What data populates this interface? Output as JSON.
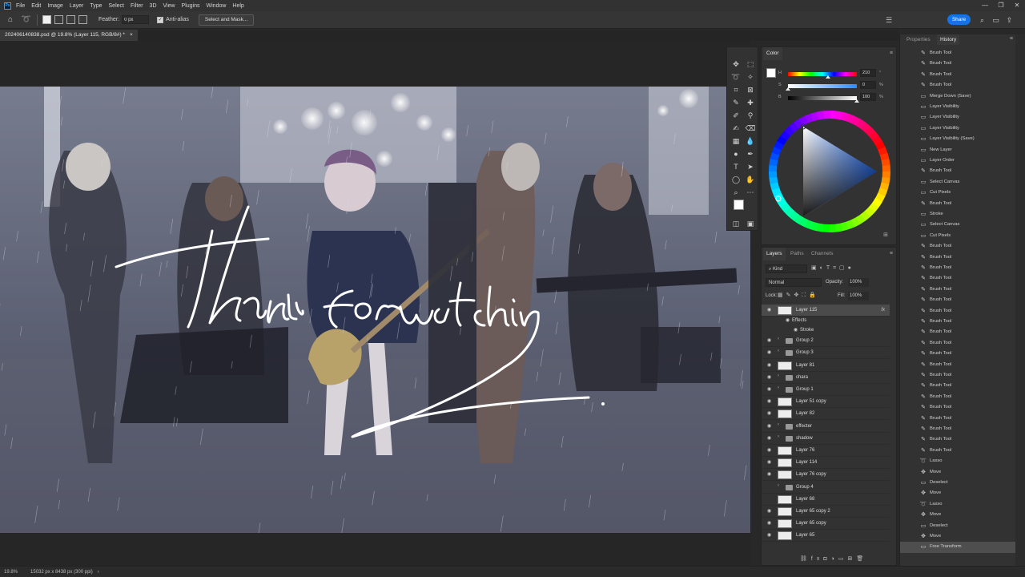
{
  "app": {
    "logo_text": "Ps"
  },
  "menu": [
    "File",
    "Edit",
    "Image",
    "Layer",
    "Type",
    "Select",
    "Filter",
    "3D",
    "View",
    "Plugins",
    "Window",
    "Help"
  ],
  "window_controls": {
    "minimize": "—",
    "restore": "❐",
    "close": "✕"
  },
  "options_bar": {
    "feather_label": "Feather:",
    "feather_value": "0 px",
    "antialias_label": "Anti-alias",
    "antialias_checked": true,
    "select_mask_label": "Select and Mask...",
    "share_label": "Share"
  },
  "document": {
    "tab_title": "202406140838.psd @ 19.8% (Layer 115, RGB/8#) *",
    "close_glyph": "×"
  },
  "artwork": {
    "handwriting": "Thanks for watching"
  },
  "color_panel": {
    "tab": "Color",
    "h_label": "H",
    "h_value": "210",
    "h_unit": "°",
    "s_label": "S",
    "s_value": "0",
    "s_unit": "%",
    "b_label": "B",
    "b_value": "100",
    "b_unit": "%",
    "h_fill": 0.58,
    "s_fill": 0.0,
    "b_fill": 1.0
  },
  "layers_panel": {
    "tabs": [
      "Layers",
      "Paths",
      "Channels"
    ],
    "kind_label": "Kind",
    "blend_mode": "Normal",
    "opacity_label": "Opacity:",
    "opacity_value": "100%",
    "lock_label": "Lock:",
    "fill_label": "Fill:",
    "fill_value": "100%",
    "fx_glyph": "fx",
    "layers": [
      {
        "name": "Layer 115",
        "type": "layer",
        "selected": true,
        "fx": true,
        "visible": true
      },
      {
        "name": "Effects",
        "type": "effect"
      },
      {
        "name": "Stroke",
        "type": "effect2"
      },
      {
        "name": "Group 2",
        "type": "group",
        "visible": true
      },
      {
        "name": "Group 3",
        "type": "group",
        "visible": true
      },
      {
        "name": "Layer 81",
        "type": "layer",
        "visible": true
      },
      {
        "name": "chara",
        "type": "group",
        "visible": true
      },
      {
        "name": "Group 1",
        "type": "group",
        "visible": true
      },
      {
        "name": "Layer 51 copy",
        "type": "layer",
        "visible": true
      },
      {
        "name": "Layer 82",
        "type": "layer",
        "visible": true
      },
      {
        "name": "effecter",
        "type": "group",
        "visible": true
      },
      {
        "name": "shadow",
        "type": "group",
        "visible": true
      },
      {
        "name": "Layer 76",
        "type": "layer",
        "visible": true
      },
      {
        "name": "Layer 114",
        "type": "layer",
        "visible": true
      },
      {
        "name": "Layer 76 copy",
        "type": "layer",
        "visible": true
      },
      {
        "name": "Group 4",
        "type": "group",
        "visible": false
      },
      {
        "name": "Layer 68",
        "type": "layer",
        "visible": false
      },
      {
        "name": "Layer 65 copy 2",
        "type": "layer",
        "visible": true
      },
      {
        "name": "Layer 65 copy",
        "type": "layer",
        "visible": true
      },
      {
        "name": "Layer 65",
        "type": "layer",
        "visible": true
      }
    ]
  },
  "history_panel": {
    "tabs": [
      "Properties",
      "History"
    ],
    "items": [
      {
        "label": "Brush Tool",
        "icon": "brush"
      },
      {
        "label": "Brush Tool",
        "icon": "brush"
      },
      {
        "label": "Brush Tool",
        "icon": "brush"
      },
      {
        "label": "Brush Tool",
        "icon": "brush"
      },
      {
        "label": "Merge Down (Save)",
        "icon": "layer"
      },
      {
        "label": "Layer Visibility",
        "icon": "layer"
      },
      {
        "label": "Layer Visibility",
        "icon": "layer"
      },
      {
        "label": "Layer Visibility",
        "icon": "layer"
      },
      {
        "label": "Layer Visibility (Save)",
        "icon": "layer"
      },
      {
        "label": "New Layer",
        "icon": "layer"
      },
      {
        "label": "Layer Order",
        "icon": "layer"
      },
      {
        "label": "Brush Tool",
        "icon": "brush"
      },
      {
        "label": "Select Canvas",
        "icon": "layer"
      },
      {
        "label": "Cut Pixels",
        "icon": "layer"
      },
      {
        "label": "Brush Tool",
        "icon": "brush"
      },
      {
        "label": "Stroke",
        "icon": "layer"
      },
      {
        "label": "Select Canvas",
        "icon": "layer"
      },
      {
        "label": "Cut Pixels",
        "icon": "layer"
      },
      {
        "label": "Brush Tool",
        "icon": "brush"
      },
      {
        "label": "Brush Tool",
        "icon": "brush"
      },
      {
        "label": "Brush Tool",
        "icon": "brush"
      },
      {
        "label": "Brush Tool",
        "icon": "brush"
      },
      {
        "label": "Brush Tool",
        "icon": "brush"
      },
      {
        "label": "Brush Tool",
        "icon": "brush"
      },
      {
        "label": "Brush Tool",
        "icon": "brush"
      },
      {
        "label": "Brush Tool",
        "icon": "brush"
      },
      {
        "label": "Brush Tool",
        "icon": "brush"
      },
      {
        "label": "Brush Tool",
        "icon": "brush"
      },
      {
        "label": "Brush Tool",
        "icon": "brush"
      },
      {
        "label": "Brush Tool",
        "icon": "brush"
      },
      {
        "label": "Brush Tool",
        "icon": "brush"
      },
      {
        "label": "Brush Tool",
        "icon": "brush"
      },
      {
        "label": "Brush Tool",
        "icon": "brush"
      },
      {
        "label": "Brush Tool",
        "icon": "brush"
      },
      {
        "label": "Brush Tool",
        "icon": "brush"
      },
      {
        "label": "Brush Tool",
        "icon": "brush"
      },
      {
        "label": "Brush Tool",
        "icon": "brush"
      },
      {
        "label": "Brush Tool",
        "icon": "brush"
      },
      {
        "label": "Lasso",
        "icon": "lasso"
      },
      {
        "label": "Move",
        "icon": "move"
      },
      {
        "label": "Deselect",
        "icon": "layer"
      },
      {
        "label": "Move",
        "icon": "move"
      },
      {
        "label": "Lasso",
        "icon": "lasso"
      },
      {
        "label": "Move",
        "icon": "move"
      },
      {
        "label": "Deselect",
        "icon": "layer"
      },
      {
        "label": "Move",
        "icon": "move"
      },
      {
        "label": "Free Transform",
        "icon": "layer",
        "selected": true
      }
    ]
  },
  "status": {
    "zoom": "19.8%",
    "doc_info": "15032 px x 8438 px (300 ppi)",
    "arrow": "›"
  },
  "colors": {
    "ui_bg": "#323232",
    "accent": "#1473e6",
    "selection": "#4b4b4b"
  }
}
